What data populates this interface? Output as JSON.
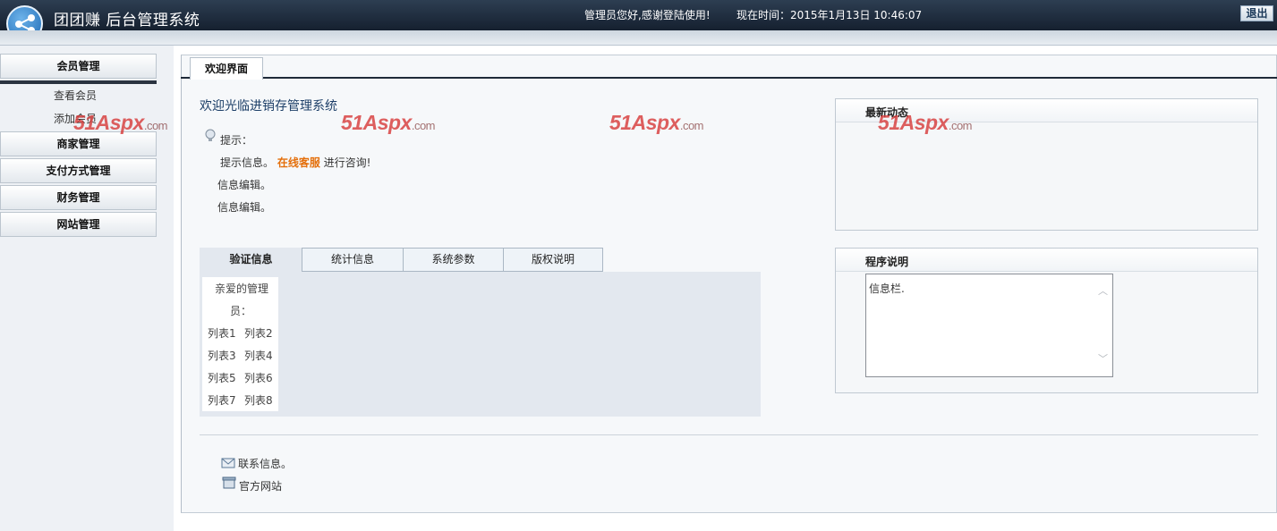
{
  "header": {
    "app_title": "团团赚  后台管理系统",
    "welcome_text": "管理员您好,感谢登陆使用!",
    "clock_text": "现在时间：2015年1月13日 10:46:07",
    "logout_label": "退出"
  },
  "sidebar": {
    "sections": [
      {
        "label": "会员管理",
        "items": [
          "查看会员",
          "添加会员"
        ]
      },
      {
        "label": "商家管理"
      },
      {
        "label": "支付方式管理"
      },
      {
        "label": "财务管理"
      },
      {
        "label": "网站管理"
      }
    ]
  },
  "main": {
    "tab_label": "欢迎界面",
    "title": "欢迎光临进销存管理系统",
    "tips_label": "提示：",
    "tip_info_prefix": "提示信息。",
    "tip_link": "在线客服",
    "tip_info_suffix": " 进行咨询!",
    "edit_lines": [
      "信息编辑。",
      "信息编辑。"
    ],
    "tabs": [
      "验证信息",
      "统计信息",
      "系统参数",
      "版权说明"
    ],
    "list_header_1": "亲爱的管理",
    "list_header_2": "员：",
    "list_items": [
      "列表1",
      "列表2",
      "列表3",
      "列表4",
      "列表5",
      "列表6",
      "列表7",
      "列表8"
    ],
    "footer": {
      "contact_label": "联系信息。",
      "website_label": "官方网站"
    }
  },
  "right": {
    "news_title": "最新动态",
    "about_title": "程序说明",
    "about_text": "信息栏."
  },
  "watermark": {
    "brand": "51Aspx",
    "suffix": ".com"
  },
  "colors": {
    "header_bg": "#1f2b3a",
    "accent_orange": "#e46f0b",
    "title_blue": "#1d3f68",
    "watermark_red": "#d73c3c"
  }
}
